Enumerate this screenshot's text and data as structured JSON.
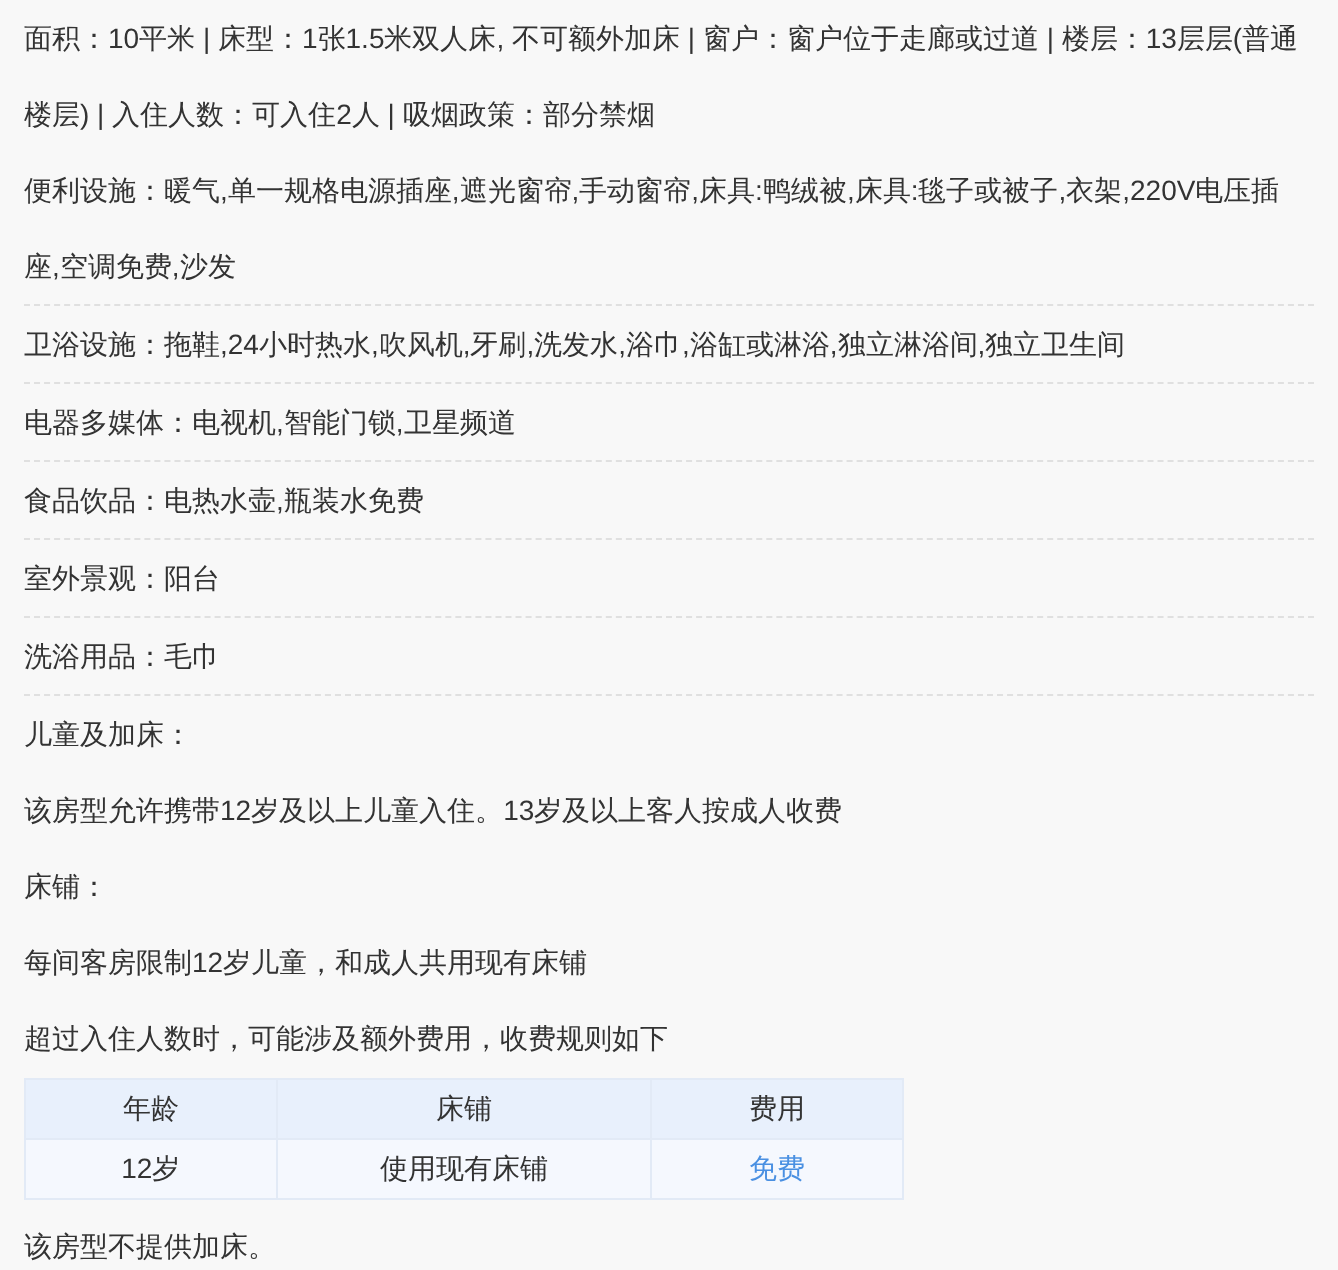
{
  "room_info": "面积：10平米 | 床型：1张1.5米双人床, 不可额外加床 | 窗户：窗户位于走廊或过道 | 楼层：13层层(普通楼层) | 入住人数：可入住2人 | 吸烟政策：部分禁烟",
  "facilities": [
    "便利设施：暖气,单一规格电源插座,遮光窗帘,手动窗帘,床具:鸭绒被,床具:毯子或被子,衣架,220V电压插座,空调免费,沙发",
    "卫浴设施：拖鞋,24小时热水,吹风机,牙刷,洗发水,浴巾,浴缸或淋浴,独立淋浴间,独立卫生间",
    "电器多媒体：电视机,智能门锁,卫星频道",
    "食品饮品：电热水壶,瓶装水免费",
    "室外景观：阳台",
    "洗浴用品：毛巾"
  ],
  "policy_lines": [
    "儿童及加床：",
    "该房型允许携带12岁及以上儿童入住。13岁及以上客人按成人收费",
    "床铺：",
    "每间客房限制12岁儿童，和成人共用现有床铺",
    "超过入住人数时，可能涉及额外费用，收费规则如下"
  ],
  "fee_table": {
    "columns": [
      "年龄",
      "床铺",
      "费用"
    ],
    "rows": [
      [
        "12岁",
        "使用现有床铺",
        "免费"
      ]
    ]
  },
  "footer_note": "该房型不提供加床。"
}
